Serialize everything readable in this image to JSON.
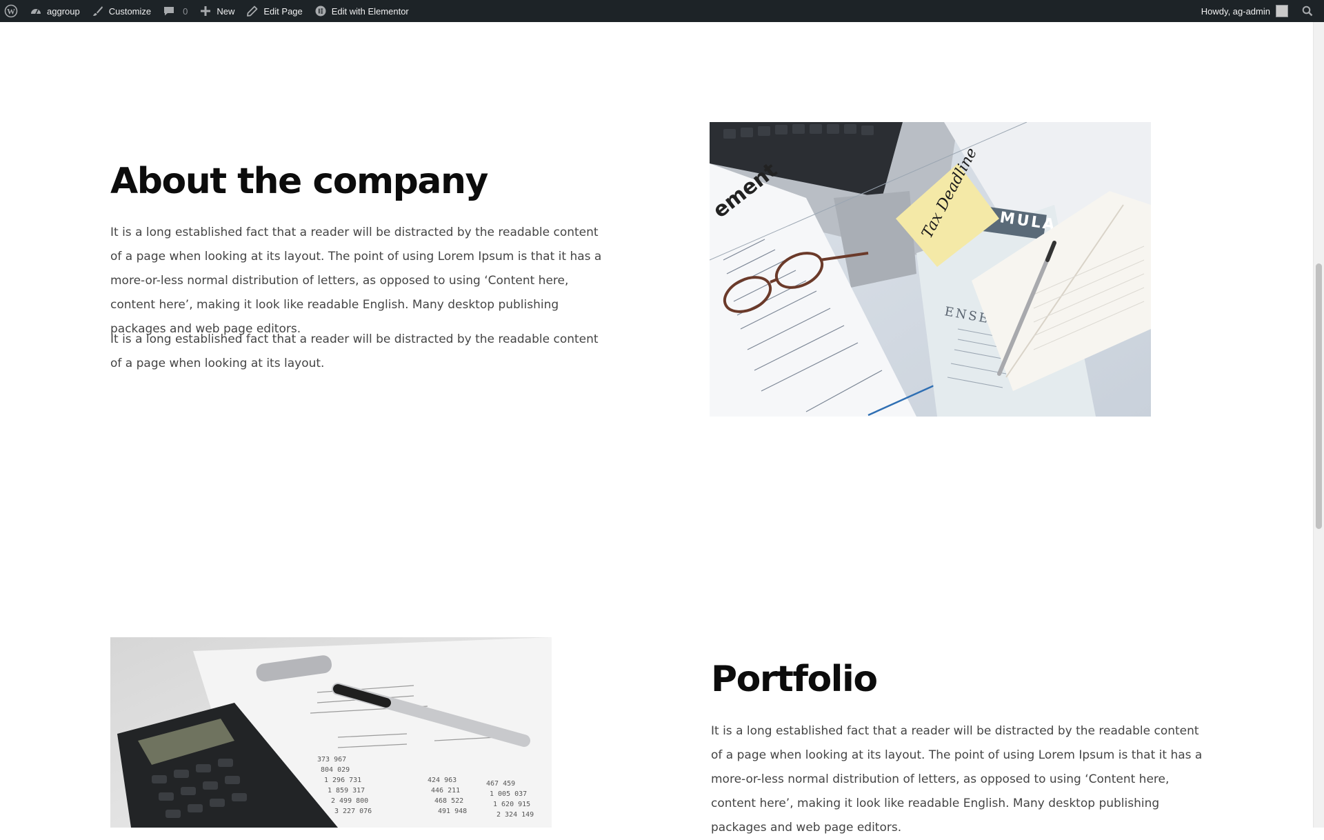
{
  "adminbar": {
    "site_name": "aggroup",
    "customize": "Customize",
    "comments_count": "0",
    "new": "New",
    "edit_page": "Edit Page",
    "edit_elementor": "Edit with Elementor",
    "howdy": "Howdy, ag-admin"
  },
  "about": {
    "title": "About the company",
    "para1": "It is a long established fact that a reader will be distracted by the readable content of a page when looking at its layout. The point of using Lorem Ipsum is that it has a more-or-less normal distribution of letters, as opposed to using ‘Content here, content here’, making it look like readable English. Many desktop publishing packages and web page editors.",
    "para2": "It is a long established fact that a reader will be distracted by the readable content of a page when looking at its layout.",
    "image": {
      "sticky_note": "Tax Deadline",
      "doc_title": "ement",
      "banner": "MULA",
      "section": "ENSES"
    }
  },
  "portfolio": {
    "title": "Portfolio",
    "para1": "It is a long established fact that a reader will be distracted by the readable content of a page when looking at its layout. The point of using Lorem Ipsum is that it has a more-or-less normal distribution of letters, as opposed to using ‘Content here, content here’, making it look like readable English. Many desktop publishing packages and web page editors."
  }
}
